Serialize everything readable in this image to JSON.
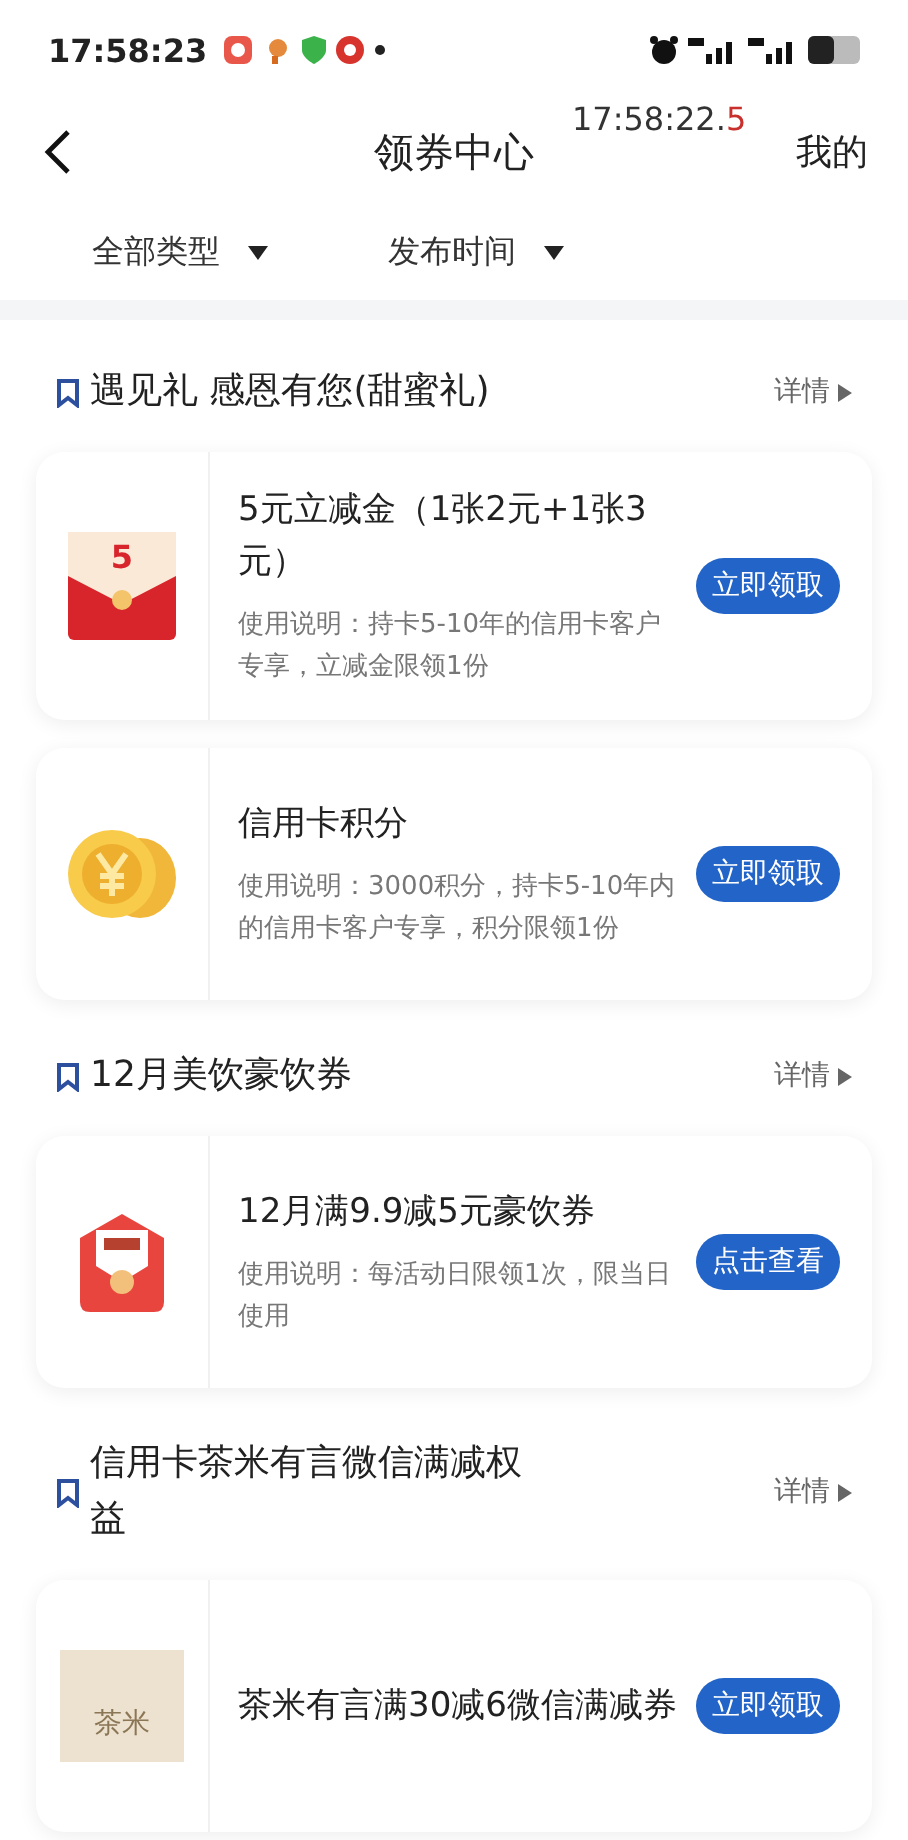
{
  "status_bar": {
    "time": "17:58:23"
  },
  "nav": {
    "title": "领券中心",
    "timer_main": "17:58:22.",
    "timer_last": "5",
    "right": "我的"
  },
  "filters": [
    {
      "label": "全部类型"
    },
    {
      "label": "发布时间"
    }
  ],
  "sections": [
    {
      "title": "遇见礼 感恩有您(甜蜜礼)",
      "details": "详情",
      "coupons": [
        {
          "kind": "envelope",
          "amount": "5",
          "title": "5元立减金（1张2元+1张3元）",
          "desc": "使用说明：持卡5-10年的信用卡客户专享，立减金限领1份",
          "button": "立即领取"
        },
        {
          "kind": "coin",
          "title": "信用卡积分",
          "desc": "使用说明：3000积分，持卡5-10年内的信用卡客户专享，积分限领1份",
          "button": "立即领取"
        }
      ]
    },
    {
      "title": "12月美饮豪饮券",
      "details": "详情",
      "coupons": [
        {
          "kind": "drink",
          "title": "12月满9.9减5元豪饮券",
          "desc": "使用说明：每活动日限领1次，限当日使用",
          "button": "点击查看"
        }
      ]
    },
    {
      "title": "信用卡茶米有言微信满减权益",
      "details": "详情",
      "coupons": [
        {
          "kind": "logo",
          "logo_text": "茶米",
          "title": "茶米有言满30减6微信满减券",
          "button": "立即领取"
        }
      ]
    }
  ]
}
